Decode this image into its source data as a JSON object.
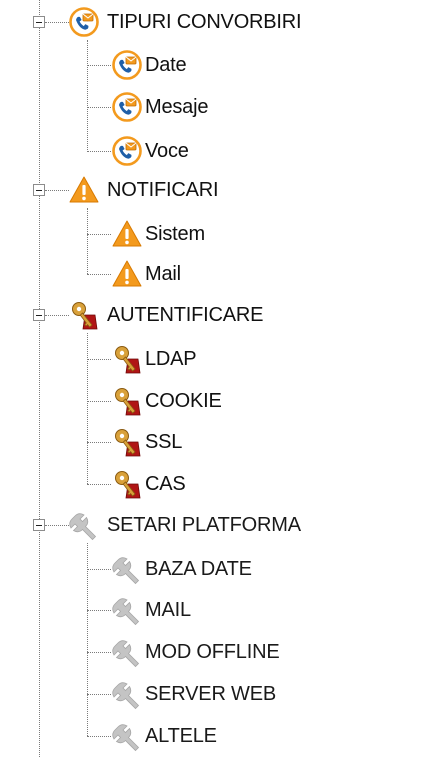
{
  "tree": {
    "groups": [
      {
        "label": "TIPURI CONVORBIRI",
        "icon": "call-message-icon",
        "expanded": true,
        "children": [
          {
            "label": "Date",
            "icon": "call-message-icon"
          },
          {
            "label": "Mesaje",
            "icon": "call-message-icon"
          },
          {
            "label": "Voce",
            "icon": "call-message-icon"
          }
        ]
      },
      {
        "label": "NOTIFICARI",
        "icon": "warning-icon",
        "expanded": true,
        "children": [
          {
            "label": "Sistem",
            "icon": "warning-icon"
          },
          {
            "label": "Mail",
            "icon": "warning-icon"
          }
        ]
      },
      {
        "label": "AUTENTIFICARE",
        "icon": "key-lock-icon",
        "expanded": true,
        "children": [
          {
            "label": "LDAP",
            "icon": "key-lock-icon"
          },
          {
            "label": "COOKIE",
            "icon": "key-lock-icon"
          },
          {
            "label": "SSL",
            "icon": "key-lock-icon"
          },
          {
            "label": "CAS",
            "icon": "key-lock-icon"
          }
        ]
      },
      {
        "label": "SETARI PLATFORMA",
        "icon": "wrench-icon",
        "expanded": true,
        "children": [
          {
            "label": "BAZA DATE",
            "icon": "wrench-icon"
          },
          {
            "label": "MAIL",
            "icon": "wrench-icon"
          },
          {
            "label": "MOD OFFLINE",
            "icon": "wrench-icon"
          },
          {
            "label": "SERVER WEB",
            "icon": "wrench-icon"
          },
          {
            "label": "ALTELE",
            "icon": "wrench-icon"
          }
        ]
      }
    ]
  },
  "colors": {
    "warning_orange": "#f39a1e",
    "phone_blue": "#1f5fa8",
    "key_gold": "#d9a13a",
    "lock_red": "#b01515",
    "wrench_gray": "#bdbdbd",
    "tree_line": "#7a7a7a"
  }
}
